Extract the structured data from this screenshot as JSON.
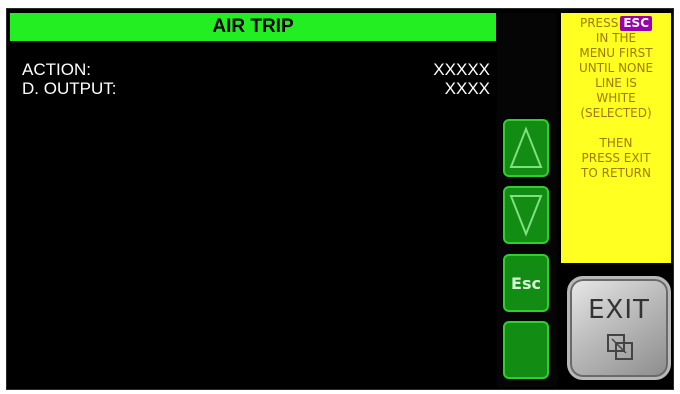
{
  "title": "AIR TRIP",
  "rows": [
    {
      "label": "ACTION:",
      "value": "XXXXX"
    },
    {
      "label": "D. OUTPUT:",
      "value": "XXXX"
    }
  ],
  "side_buttons": {
    "up_icon": "triangle-up-icon",
    "down_icon": "triangle-down-icon",
    "esc_label": "Esc",
    "blank_icon": "none"
  },
  "hint": {
    "line1_prefix": "PRESS",
    "line1_badge": "ESC",
    "line2": "IN THE",
    "line3": "MENU FIRST",
    "line4": "UNTIL NONE",
    "line5": "LINE IS",
    "line6": "WHITE",
    "line7": "(SELECTED)",
    "line8": "THEN",
    "line9": "PRESS EXIT",
    "line10": "TO RETURN"
  },
  "exit_button": {
    "label": "EXIT",
    "icon": "overlapping-squares-icon"
  },
  "colors": {
    "title_bar": "#22ee22",
    "screen_bg": "#000000",
    "text": "#ffffff",
    "side_button": "#138c13",
    "hint_bg": "#ffff22",
    "esc_badge": "#9900aa"
  }
}
